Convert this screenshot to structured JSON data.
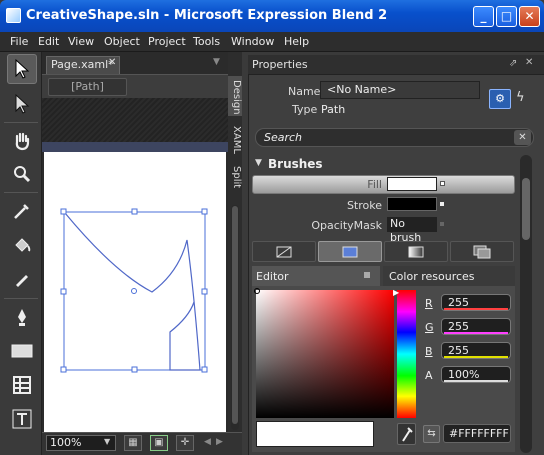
{
  "window": {
    "title": "CreativeShape.sln - Microsoft Expression Blend 2",
    "minimize": "_",
    "maximize": "□",
    "close": "✕"
  },
  "menu": [
    "File",
    "Edit",
    "View",
    "Object",
    "Project",
    "Tools",
    "Window",
    "Help"
  ],
  "tools": [
    "selection-tool-icon",
    "direct-selection-tool-icon",
    "pan-tool-icon",
    "zoom-tool-icon",
    "eyedropper-tool-icon",
    "paint-bucket-tool-icon",
    "brush-transform-tool-icon",
    "pen-tool-icon",
    "rectangle-tool-icon",
    "grid-tool-icon",
    "text-tool-icon"
  ],
  "document": {
    "tab_label": "Page.xaml*",
    "tab_close": "✕",
    "breadcrumb": "[Path]",
    "side_tabs": {
      "design": "Design",
      "xaml": "XAML",
      "split": "Split"
    },
    "zoom": "100%"
  },
  "properties": {
    "title": "Properties",
    "name_label": "Name",
    "name_value": "<No Name>",
    "type_label": "Type",
    "type_value": "Path",
    "search_placeholder": "Search",
    "brushes_title": "Brushes",
    "fill_label": "Fill",
    "stroke_label": "Stroke",
    "opacity_mask_label": "OpacityMask",
    "opacity_mask_value": "No brush",
    "editor_tab": "Editor",
    "color_resources_tab": "Color resources",
    "channels": [
      {
        "label": "R",
        "value": "255",
        "color": "#ff4040"
      },
      {
        "label": "G",
        "value": "255",
        "color": "#ff40ff"
      },
      {
        "label": "B",
        "value": "255",
        "color": "#e0e000"
      },
      {
        "label": "A",
        "value": "100%",
        "color": "#dddddd"
      }
    ],
    "hex_value": "#FFFFFFFF",
    "fill_color": "#FFFFFF",
    "stroke_color": "#000000"
  }
}
